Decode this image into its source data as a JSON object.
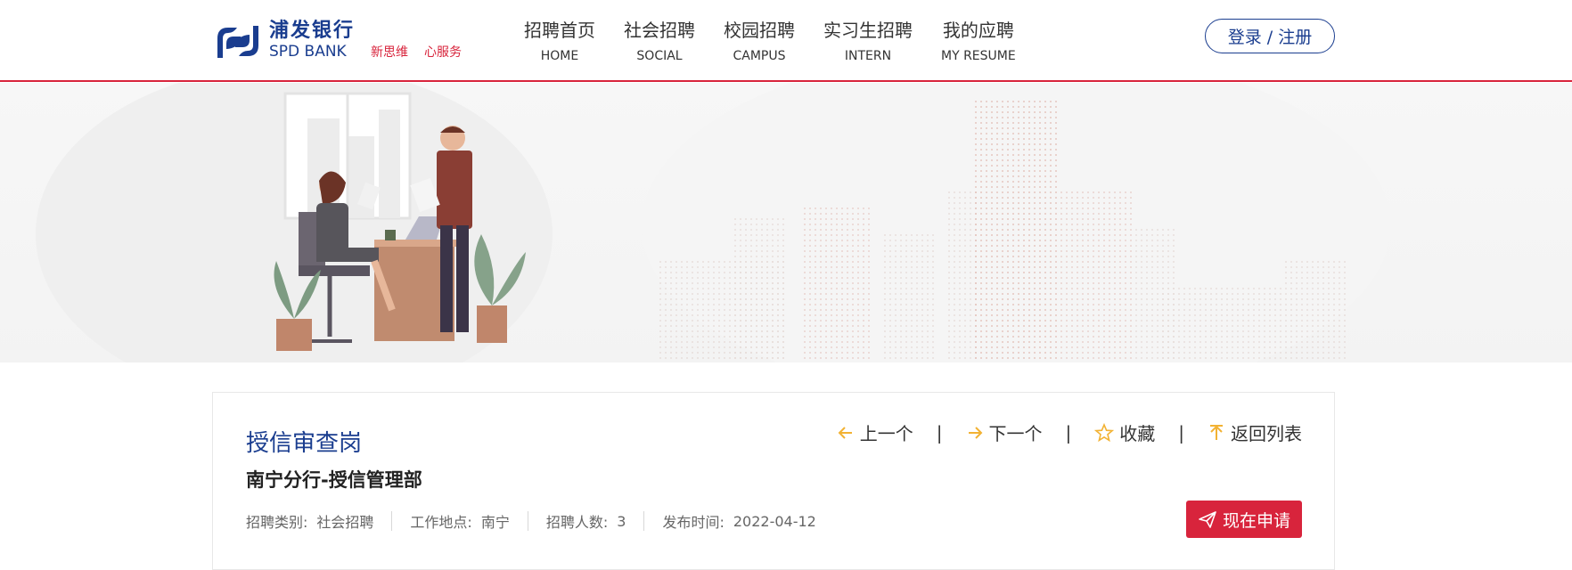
{
  "header": {
    "logo_cn": "浦发银行",
    "logo_en": "SPD BANK",
    "slogan": [
      "新思维",
      "心服务"
    ],
    "nav": [
      {
        "cn": "招聘首页",
        "en": "HOME"
      },
      {
        "cn": "社会招聘",
        "en": "SOCIAL"
      },
      {
        "cn": "校园招聘",
        "en": "CAMPUS"
      },
      {
        "cn": "实习生招聘",
        "en": "INTERN"
      },
      {
        "cn": "我的应聘",
        "en": "MY RESUME"
      }
    ],
    "login": "登录 / 注册"
  },
  "job": {
    "title": "授信审查岗",
    "department": "南宁分行-授信管理部",
    "meta": [
      {
        "label": "招聘类别:",
        "value": "社会招聘"
      },
      {
        "label": "工作地点:",
        "value": "南宁"
      },
      {
        "label": "招聘人数:",
        "value": "3"
      },
      {
        "label": "发布时间:",
        "value": "2022-04-12"
      }
    ],
    "actions": {
      "prev": "上一个",
      "next": "下一个",
      "favorite": "收藏",
      "back": "返回列表"
    },
    "apply": "现在申请"
  },
  "colors": {
    "brand_blue": "#1a3d8f",
    "brand_red": "#d8243c",
    "icon_yellow": "#f2b233"
  },
  "icons": [
    "left-arrow-icon",
    "right-arrow-icon",
    "star-icon",
    "up-arrow-icon",
    "paper-plane-icon"
  ]
}
